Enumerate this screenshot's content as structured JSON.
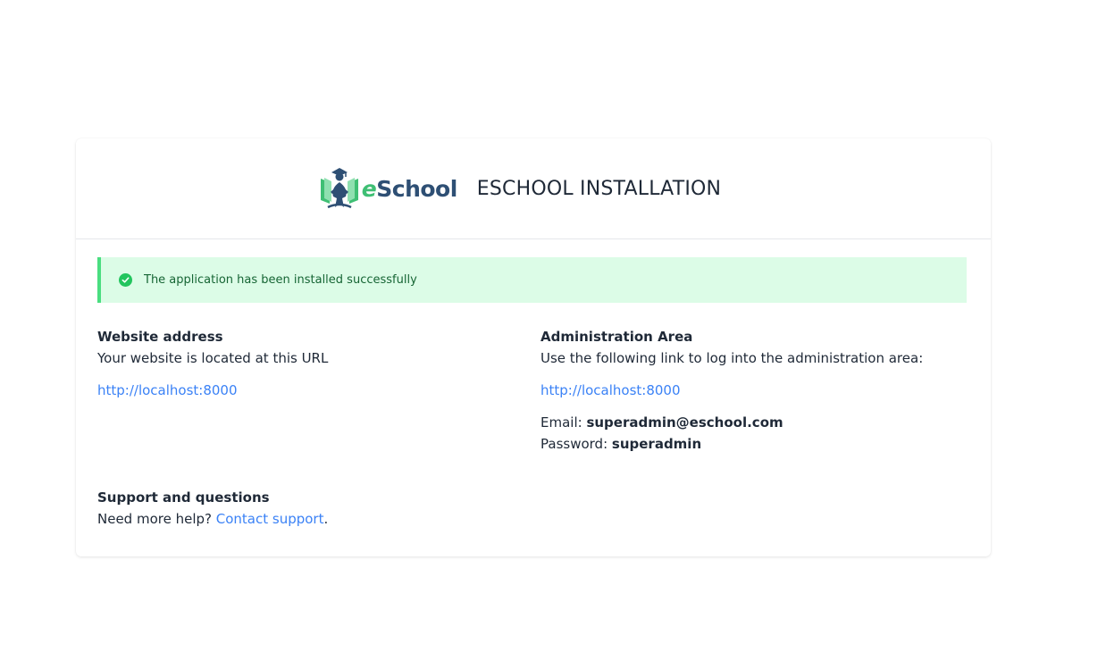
{
  "header": {
    "logo": {
      "brand_e": "e",
      "brand_rest": "School",
      "icon": "eschool-logo-icon",
      "colors": {
        "green": "#3fbf74",
        "navy": "#2e4f74"
      }
    },
    "title": "ESCHOOL INSTALLATION"
  },
  "alert": {
    "icon": "check-circle-icon",
    "message": "The application has been installed successfully",
    "colors": {
      "background": "#dcfce7",
      "border": "#4ade80",
      "text": "#166534"
    }
  },
  "website": {
    "title": "Website address",
    "description": "Your website is located at this URL",
    "url": "http://localhost:8000"
  },
  "admin": {
    "title": "Administration Area",
    "description": "Use the following link to log into the administration area:",
    "url": "http://localhost:8000",
    "email_label": "Email:",
    "email": "superadmin@eschool.com",
    "password_label": "Password:",
    "password": "superadmin"
  },
  "support": {
    "title": "Support and questions",
    "text": "Need more help?",
    "link": "Contact support",
    "suffix": "."
  },
  "colors": {
    "link": "#3b82f6"
  }
}
